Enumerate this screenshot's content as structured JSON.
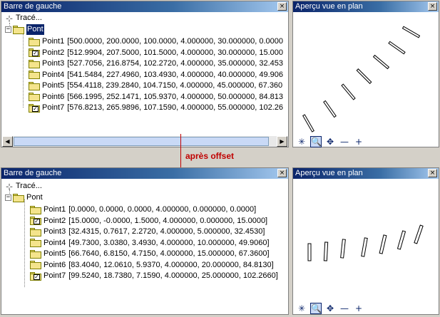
{
  "top": {
    "left_title": "Barre de gauche",
    "right_title": "Aperçu vue en plan",
    "trace_label": "Tracé...",
    "root_label": "Pont",
    "points": [
      {
        "label": "Point1",
        "values": "[500.0000, 200.0000, 100.0000, 4.000000, 30.000000, 0.0000",
        "checked": false
      },
      {
        "label": "Point2",
        "values": "[512.9904, 207.5000, 101.5000, 4.000000, 30.000000, 15.000",
        "checked": true
      },
      {
        "label": "Point3",
        "values": "[527.7056, 216.8754, 102.2720, 4.000000, 35.000000, 32.453",
        "checked": false
      },
      {
        "label": "Point4",
        "values": "[541.5484, 227.4960, 103.4930, 4.000000, 40.000000, 49.906",
        "checked": false
      },
      {
        "label": "Point5",
        "values": "[554.4118, 239.2840, 104.7150, 4.000000, 45.000000, 67.360",
        "checked": false
      },
      {
        "label": "Point6",
        "values": "[566.1995, 252.1471, 105.9370, 4.000000, 50.000000, 84.813",
        "checked": false
      },
      {
        "label": "Point7",
        "values": "[576.8213, 265.9896, 107.1590, 4.000000, 55.000000, 102.26",
        "checked": true
      }
    ]
  },
  "bottom": {
    "left_title": "Barre de gauche",
    "right_title": "Aperçu vue en plan",
    "trace_label": "Tracé...",
    "root_label": "Pont",
    "points": [
      {
        "label": "Point1",
        "values": "[0.0000, 0.0000, 0.0000, 4.000000, 0.000000, 0.0000]",
        "checked": false
      },
      {
        "label": "Point2",
        "values": "[15.0000, -0.0000, 1.5000, 4.000000, 0.000000, 15.0000]",
        "checked": true
      },
      {
        "label": "Point3",
        "values": "[32.4315, 0.7617, 2.2720, 4.000000, 5.000000, 32.4530]",
        "checked": false
      },
      {
        "label": "Point4",
        "values": "[49.7300, 3.0380, 3.4930, 4.000000, 10.000000, 49.9060]",
        "checked": false
      },
      {
        "label": "Point5",
        "values": "[66.7640, 6.8150, 4.7150, 4.000000, 15.000000, 67.3600]",
        "checked": false
      },
      {
        "label": "Point6",
        "values": "[83.4040, 12.0610, 5.9370, 4.000000, 20.000000, 84.8130]",
        "checked": false
      },
      {
        "label": "Point7",
        "values": "[99.5240, 18.7380, 7.1590, 4.000000, 25.000000, 102.2660]",
        "checked": true
      }
    ]
  },
  "transition_label": "après offset",
  "close_glyph": "×",
  "toolbar_icons": [
    "snowflake-icon",
    "zoom-icon",
    "pan-icon",
    "zoom-out-icon",
    "zoom-in-icon"
  ],
  "toolbar_glyphs": [
    "✳",
    "🔍",
    "✥",
    "—",
    "+"
  ],
  "accent_color": "#0a246a",
  "arrow_color": "#c00000"
}
